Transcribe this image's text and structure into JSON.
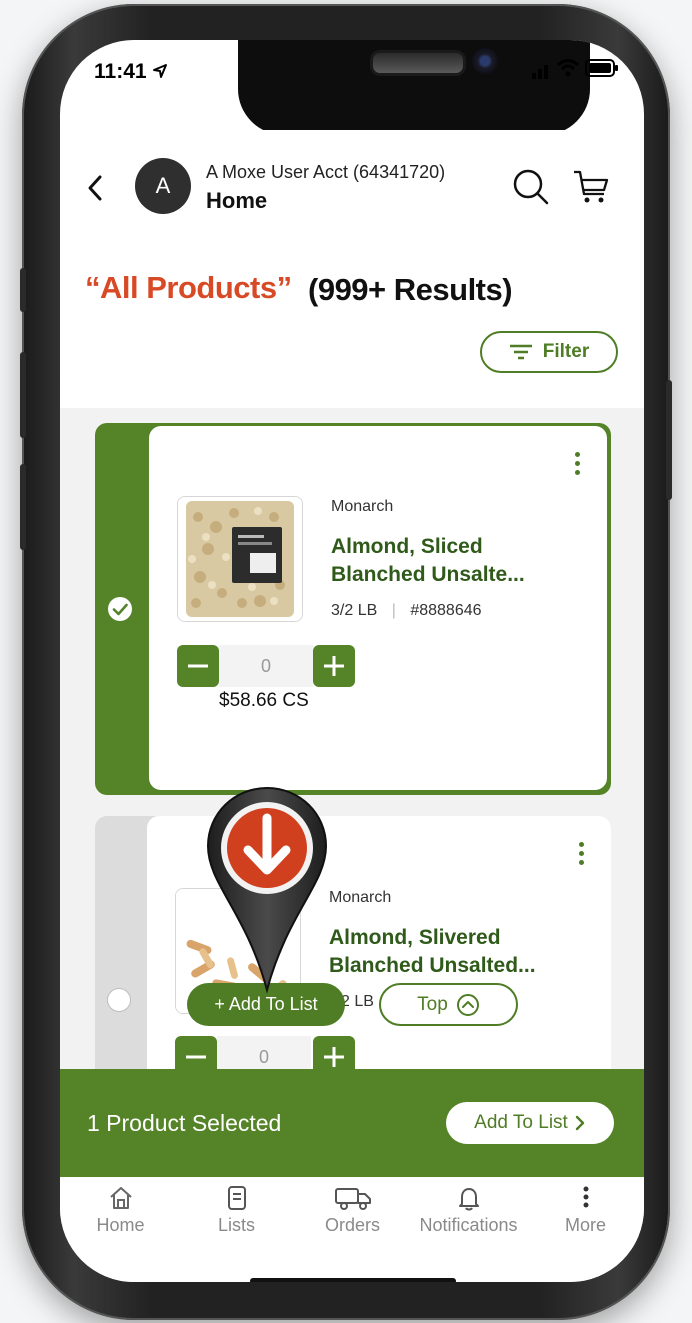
{
  "status_bar": {
    "time": "11:41"
  },
  "header": {
    "avatar_initial": "A",
    "account_name": "A Moxe User Acct (64341720)",
    "location": "Home"
  },
  "search": {
    "query_label": "“All Products”",
    "result_count": "(999+ Results)",
    "filter_label": "Filter"
  },
  "products": [
    {
      "brand": "Monarch",
      "name_line1": "Almond, Sliced",
      "name_line2": "Blanched Unsalte...",
      "pack": "3/2 LB",
      "separator": "|",
      "item_number": "#8888646",
      "quantity": "0",
      "price": "$58.66 CS",
      "selected": true
    },
    {
      "brand": "Monarch",
      "name_line1": "Almond, Slivered",
      "name_line2": "Blanched Unsalted...",
      "pack": "2 LB",
      "quantity": "0",
      "selected": false
    }
  ],
  "overlay": {
    "add_to_list_label": "+ Add To List",
    "top_label": "Top"
  },
  "selection_bar": {
    "text": "1 Product Selected",
    "button_label": "Add To List"
  },
  "tabbar": {
    "items": [
      {
        "label": "Home",
        "icon": "home-icon"
      },
      {
        "label": "Lists",
        "icon": "list-icon"
      },
      {
        "label": "Orders",
        "icon": "truck-icon"
      },
      {
        "label": "Notifications",
        "icon": "bell-icon"
      },
      {
        "label": "More",
        "icon": "more-icon"
      }
    ]
  },
  "colors": {
    "brand_green": "#548427",
    "accent_orange": "#d84a26",
    "pin_red": "#d1401e"
  }
}
